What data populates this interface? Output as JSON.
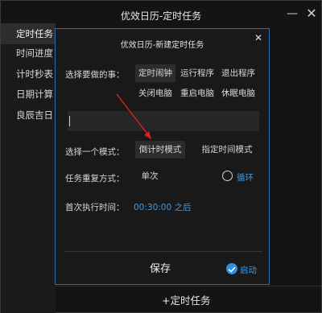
{
  "window": {
    "title": "优效日历-定时任务",
    "minimize_symbol": "—",
    "close_symbol": "✕"
  },
  "sidebar": {
    "items": [
      {
        "label": "定时任务",
        "active": true
      },
      {
        "label": "时间进度",
        "active": false
      },
      {
        "label": "计时秒表",
        "active": false
      },
      {
        "label": "日期计算",
        "active": false
      },
      {
        "label": "良辰吉日",
        "active": false
      }
    ]
  },
  "footer": {
    "add_label": "+定时任务"
  },
  "dialog": {
    "title": "优效日历-新建定时任务",
    "close_symbol": "✕",
    "task_label": "选择要做的事：",
    "task_options": [
      {
        "label": "定时闹钟",
        "selected": true
      },
      {
        "label": "运行程序",
        "selected": false
      },
      {
        "label": "退出程序",
        "selected": false
      },
      {
        "label": "关闭电脑",
        "selected": false
      },
      {
        "label": "重启电脑",
        "selected": false
      },
      {
        "label": "休眠电脑",
        "selected": false
      }
    ],
    "input_value": "",
    "mode_label": "选择一个模式：",
    "mode_options": [
      {
        "label": "倒计时模式",
        "selected": true
      },
      {
        "label": "指定时间模式",
        "selected": false
      }
    ],
    "repeat_label": "任务重复方式：",
    "repeat_option": "单次",
    "loop_label": "循环",
    "loop_checked": false,
    "first_exec_label": "首次执行时间：",
    "first_exec_value": "00:30:00 之后",
    "save_label": "保存",
    "start_label": "启动",
    "start_checked": true
  },
  "colors": {
    "accent": "#3b9be8",
    "dialog_border": "#2a6fa8",
    "annotation_arrow": "#e02020"
  }
}
